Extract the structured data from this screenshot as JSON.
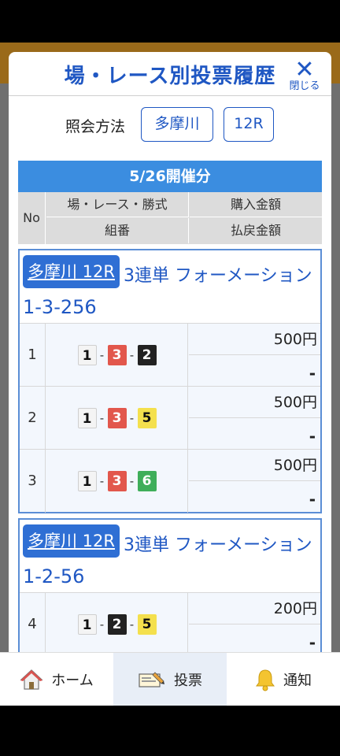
{
  "modal": {
    "title": "場・レース別投票履歴",
    "close_label": "閉じる",
    "query_label": "照会方法",
    "venue_button": "多摩川",
    "race_button": "12R"
  },
  "table": {
    "date": "5/26開催分",
    "headers": {
      "no": "No",
      "venue_race_type": "場・レース・勝式",
      "purchase_amount": "購入金額",
      "combination": "組番",
      "payout_amount": "払戻金額"
    },
    "groups": [
      {
        "venue": "多摩川 12R",
        "bet_type": "3連単 フォーメーション",
        "combo": "1-3-256",
        "rows": [
          {
            "no": "1",
            "n1": "1",
            "n2": "3",
            "n3": "2",
            "amount": "500円",
            "payout": "-"
          },
          {
            "no": "2",
            "n1": "1",
            "n2": "3",
            "n3": "5",
            "amount": "500円",
            "payout": "-"
          },
          {
            "no": "3",
            "n1": "1",
            "n2": "3",
            "n3": "6",
            "amount": "500円",
            "payout": "-"
          }
        ]
      },
      {
        "venue": "多摩川 12R",
        "bet_type": "3連単 フォーメーション",
        "combo": "1-2-56",
        "rows": [
          {
            "no": "4",
            "n1": "1",
            "n2": "2",
            "n3": "5",
            "amount": "200円",
            "payout": "-"
          }
        ]
      }
    ]
  },
  "boat_colors": {
    "1": {
      "bg": "#f4f4f4",
      "fg": "#111111"
    },
    "2": {
      "bg": "#222222",
      "fg": "#ffffff"
    },
    "3": {
      "bg": "#e2574c",
      "fg": "#ffffff"
    },
    "4": {
      "bg": "#2f6fd4",
      "fg": "#ffffff"
    },
    "5": {
      "bg": "#f4e04d",
      "fg": "#111111"
    },
    "6": {
      "bg": "#3fae5a",
      "fg": "#ffffff"
    }
  },
  "nav": {
    "items": [
      {
        "label": "ホーム",
        "icon": "home-icon"
      },
      {
        "label": "投票",
        "icon": "ticket-icon"
      },
      {
        "label": "通知",
        "icon": "bell-icon"
      }
    ],
    "active": 1
  },
  "colors": {
    "accent": "#1f57c3",
    "date_bar": "#3b8de0"
  }
}
